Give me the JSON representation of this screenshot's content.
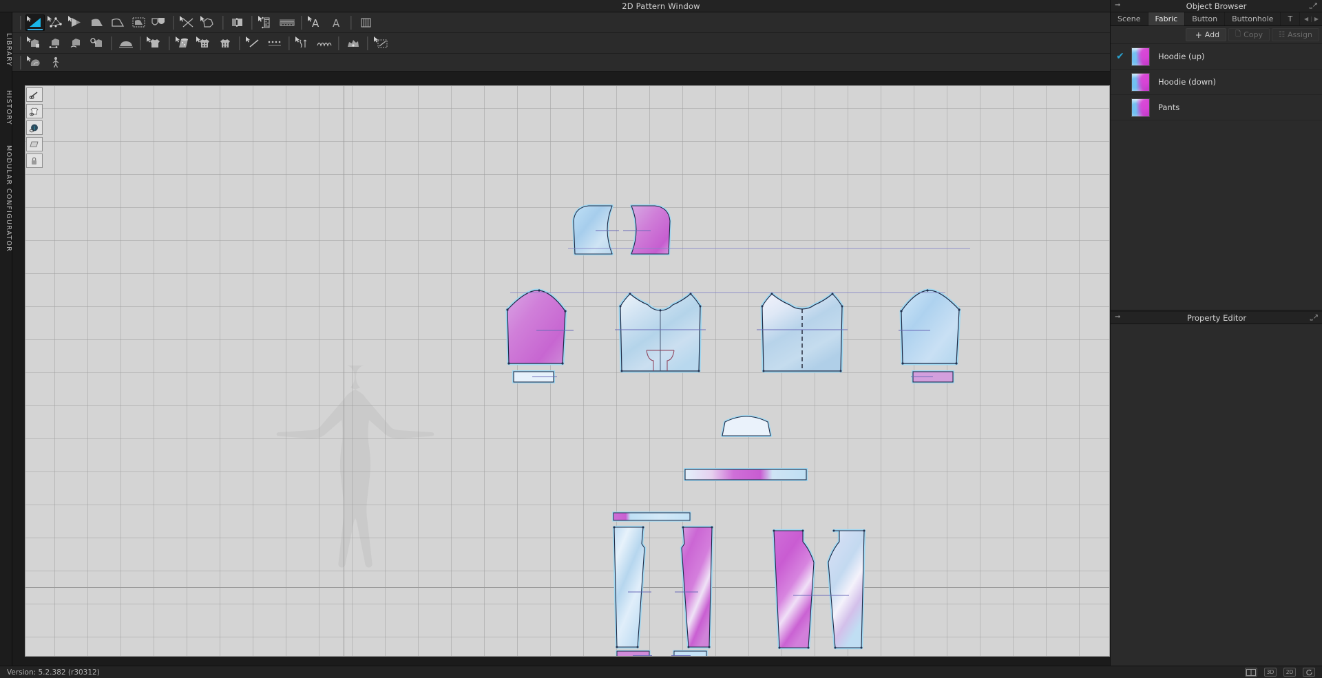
{
  "window": {
    "title": "2D Pattern Window",
    "undock_icon": "undock-icon"
  },
  "left_rail": {
    "tabs": [
      {
        "label": "LIBRARY",
        "name": "library"
      },
      {
        "label": "HISTORY",
        "name": "history"
      },
      {
        "label": "MODULAR CONFIGURATOR",
        "name": "modular-configurator"
      }
    ]
  },
  "toolbar": {
    "row1": [
      {
        "icon": "transform-pattern-icon",
        "active": true
      },
      {
        "icon": "edit-pattern-icon",
        "active": false
      },
      {
        "icon": "edit-curvature-icon",
        "active": false
      },
      {
        "icon": "polygon-select-icon",
        "active": false
      },
      {
        "icon": "create-rectangle-icon",
        "active": false
      },
      {
        "icon": "trace-pattern-icon",
        "active": false
      },
      {
        "icon": "internal-polygon-icon",
        "active": false
      },
      {
        "icon": "slash-spread-icon",
        "active": false
      },
      {
        "icon": "pleat-icon",
        "active": false
      },
      {
        "icon": "fold-pattern-icon",
        "active": false
      },
      {
        "icon": "measure-tape-icon",
        "active": false
      },
      {
        "icon": "ruler-icon",
        "active": false
      },
      {
        "icon": "text-tool-icon",
        "active": false
      },
      {
        "icon": "text-edit-icon",
        "active": false
      },
      {
        "icon": "grading-icon",
        "active": false
      }
    ],
    "row2": [
      {
        "icon": "sewing-segment-icon",
        "active": false
      },
      {
        "icon": "sewing-free-icon",
        "active": false
      },
      {
        "icon": "sewing-curve-icon",
        "active": false
      },
      {
        "icon": "check-sewing-icon",
        "active": false
      },
      {
        "icon": "iron-flat-icon",
        "active": false
      },
      {
        "icon": "fabric-shirt-icon",
        "active": false
      },
      {
        "icon": "roll-fabric-icon",
        "active": false
      },
      {
        "icon": "button-shirt-icon",
        "active": false
      },
      {
        "icon": "buttonhole-shirt-icon",
        "active": false
      },
      {
        "icon": "line-tool-icon",
        "active": false
      },
      {
        "icon": "dotted-line-icon",
        "active": false
      },
      {
        "icon": "elastic-icon",
        "active": false
      },
      {
        "icon": "zigzag-stitch-icon",
        "active": false
      },
      {
        "icon": "puckering-icon",
        "active": false
      },
      {
        "icon": "topstitch-select-icon",
        "active": false
      }
    ],
    "row3": [
      {
        "icon": "bonding-icon",
        "active": false
      },
      {
        "icon": "avatar-pose-icon",
        "active": false
      }
    ]
  },
  "canvas_tools": [
    {
      "icon": "show-pattern-outline-icon"
    },
    {
      "icon": "show-garment-icon"
    },
    {
      "icon": "show-info-icon"
    },
    {
      "icon": "show-layers-icon"
    },
    {
      "icon": "lock-pattern-icon"
    }
  ],
  "object_browser": {
    "title": "Object Browser",
    "pin_icon": "pin-icon",
    "undock_icon": "undock-icon",
    "tabs": [
      {
        "label": "Scene",
        "selected": false
      },
      {
        "label": "Fabric",
        "selected": true
      },
      {
        "label": "Button",
        "selected": false
      },
      {
        "label": "Buttonhole",
        "selected": false
      },
      {
        "label": "T",
        "selected": false
      }
    ],
    "tab_prev_icon": "chevron-left-icon",
    "tab_next_icon": "chevron-right-icon",
    "actions": {
      "add_label": "Add",
      "add_icon": "plus-icon",
      "copy_label": "Copy",
      "copy_icon": "copy-icon",
      "assign_label": "Assign",
      "assign_icon": "assign-icon"
    },
    "fabrics": [
      {
        "name": "Hoodie (up)",
        "checked": true
      },
      {
        "name": "Hoodie (down)",
        "checked": false
      },
      {
        "name": "Pants",
        "checked": false
      }
    ],
    "check_glyph": "✔"
  },
  "property_editor": {
    "title": "Property Editor",
    "pin_icon": "pin-icon",
    "undock_icon": "undock-icon"
  },
  "status_bar": {
    "version": "Version: 5.2.382 (r30312)",
    "buttons": [
      {
        "label": "",
        "name": "split-view-icon"
      },
      {
        "label": "3D",
        "name": "view-3d-button"
      },
      {
        "label": "2D",
        "name": "view-2d-button"
      },
      {
        "label": "",
        "name": "reset-view-icon"
      }
    ]
  },
  "colors": {
    "accent": "#29a5d4",
    "panel_bg": "#2b2b2b",
    "canvas_bg": "#d4d4d4",
    "fabric_pink": "#c93fc9",
    "fabric_blue": "#9fd0ef",
    "outline": "#2b3a66",
    "baseline": "#7b7bc4"
  }
}
